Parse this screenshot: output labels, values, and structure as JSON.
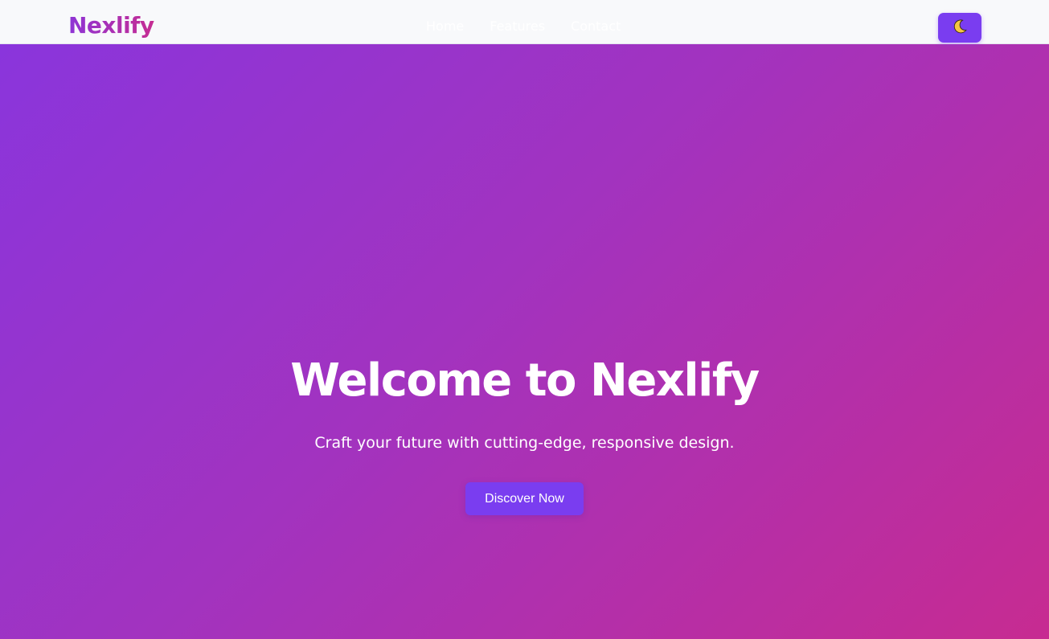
{
  "navbar": {
    "logo": "Nexlify",
    "links": [
      {
        "label": "Home"
      },
      {
        "label": "Features"
      },
      {
        "label": "Contact"
      }
    ],
    "theme_toggle_icon": "crescent-moon-icon"
  },
  "hero": {
    "title": "Welcome to Nexlify",
    "subtitle": "Craft your future with cutting-edge, responsive design.",
    "cta_label": "Discover Now"
  },
  "colors": {
    "accent": "#7a3df0",
    "gradient_start": "#8a35dc",
    "gradient_end": "#c72b91",
    "navbar_bg": "#f8f9fb",
    "moon": "#f5c542"
  }
}
